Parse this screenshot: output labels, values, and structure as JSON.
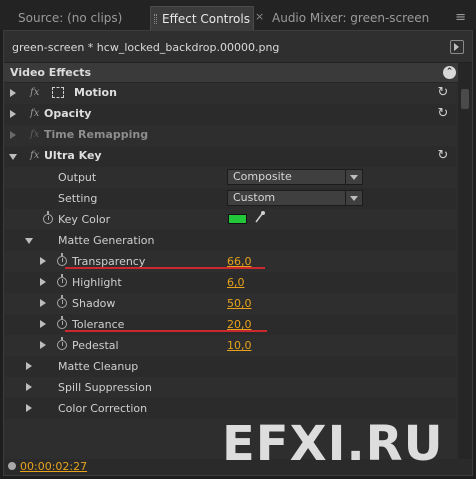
{
  "tabs": [
    {
      "label": "Source: (no clips)"
    },
    {
      "label": "Effect Controls"
    },
    {
      "label": "Audio Mixer: green-screen"
    }
  ],
  "tab_close": "×",
  "panel_menu_icon": "menu-icon",
  "clip": {
    "name": "green-screen * hcw_locked_backdrop.00000.png"
  },
  "section": {
    "title": "Video Effects",
    "collapse_icon": "⊗"
  },
  "effects": {
    "motion": "Motion",
    "opacity": "Opacity",
    "time_remapping": "Time Remapping",
    "ultra_key": "Ultra Key"
  },
  "fx_glyph": "fx",
  "reset_glyph": "↻",
  "props": {
    "output": {
      "label": "Output",
      "value": "Composite"
    },
    "setting": {
      "label": "Setting",
      "value": "Custom"
    },
    "key_color": {
      "label": "Key Color",
      "color": "#22c73a"
    },
    "matte_generation": "Matte Generation",
    "transparency": {
      "label": "Transparency",
      "value": "66,0"
    },
    "highlight": {
      "label": "Highlight",
      "value": "6,0"
    },
    "shadow": {
      "label": "Shadow",
      "value": "50,0"
    },
    "tolerance": {
      "label": "Tolerance",
      "value": "20,0"
    },
    "pedestal": {
      "label": "Pedestal",
      "value": "10,0"
    },
    "matte_cleanup": "Matte Cleanup",
    "spill_suppression": "Spill Suppression",
    "color_correction": "Color Correction"
  },
  "footer": {
    "timecode": "00:00:02:27"
  },
  "watermark": "EFXI.RU",
  "colors": {
    "value_orange": "#e6a21c",
    "annotation_red": "#c8282e",
    "key_green": "#22c73a"
  }
}
